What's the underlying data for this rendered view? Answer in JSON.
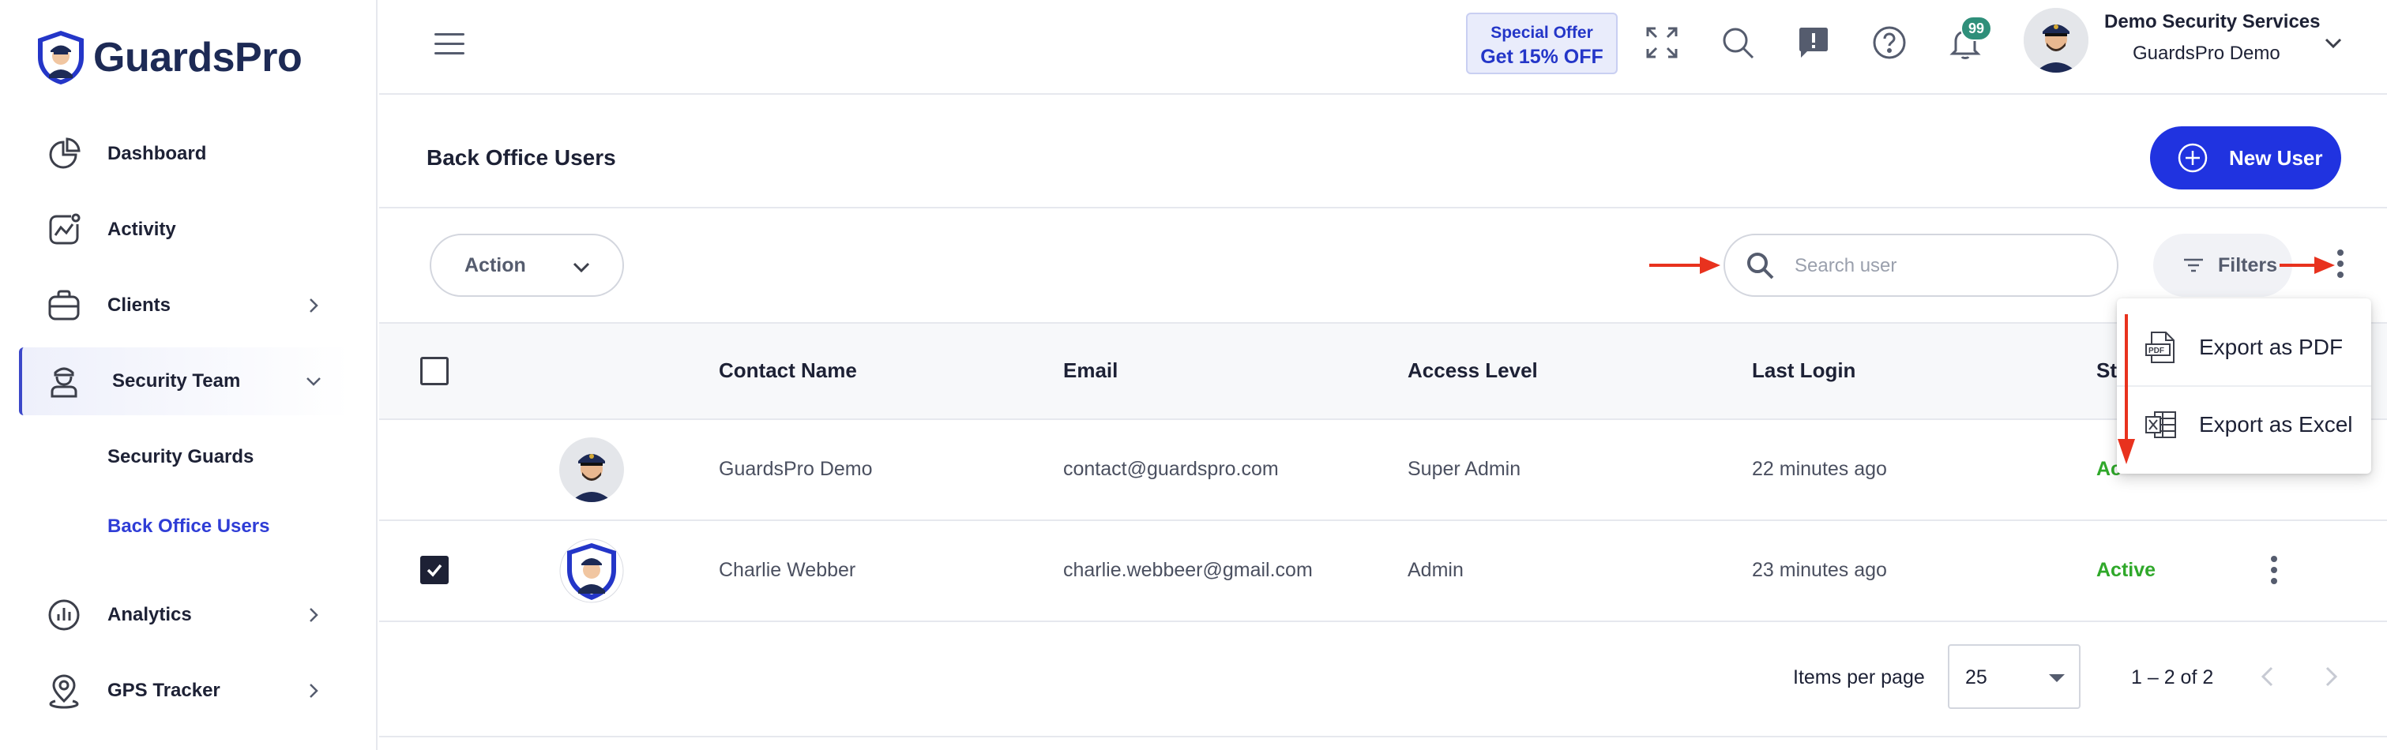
{
  "brand": {
    "name": "GuardsPro"
  },
  "sidebar": {
    "items": [
      {
        "label": "Dashboard",
        "icon": "pie-chart-icon"
      },
      {
        "label": "Activity",
        "icon": "activity-icon"
      },
      {
        "label": "Clients",
        "icon": "briefcase-icon"
      },
      {
        "label": "Security Team",
        "icon": "guard-icon"
      },
      {
        "label": "Analytics",
        "icon": "analytics-icon"
      },
      {
        "label": "GPS Tracker",
        "icon": "map-pin-icon"
      }
    ],
    "subitems": [
      {
        "label": "Security Guards"
      },
      {
        "label": "Back Office Users"
      }
    ],
    "active_item": "Security Team",
    "current_subitem": "Back Office Users"
  },
  "topbar": {
    "offer_line1": "Special Offer",
    "offer_line2": "Get 15% OFF",
    "notification_count": "99",
    "company_name": "Demo Security Services",
    "user_name": "GuardsPro Demo"
  },
  "page": {
    "title": "Back Office Users",
    "new_user_label": "New User"
  },
  "toolbar": {
    "action_label": "Action",
    "search_placeholder": "Search user",
    "filters_label": "Filters"
  },
  "table": {
    "columns": [
      "Contact Name",
      "Email",
      "Access Level",
      "Last Login",
      "St"
    ],
    "rows": [
      {
        "checked": false,
        "name": "GuardsPro Demo",
        "email": "contact@guardspro.com",
        "access": "Super Admin",
        "last_login": "22 minutes ago",
        "status": "Ac"
      },
      {
        "checked": true,
        "name": "Charlie Webber",
        "email": "charlie.webbeer@gmail.com",
        "access": "Admin",
        "last_login": "23 minutes ago",
        "status": "Active"
      }
    ]
  },
  "paginator": {
    "items_per_page_label": "Items per page",
    "items_per_page_value": "25",
    "range_label": "1 – 2 of 2"
  },
  "export_menu": {
    "items": [
      {
        "label": "Export as PDF",
        "icon": "pdf-file-icon"
      },
      {
        "label": "Export as Excel",
        "icon": "excel-file-icon"
      }
    ]
  },
  "colors": {
    "primary": "#2033e0",
    "active_nav": "#2f3dd6",
    "status_active": "#2fa82a",
    "badge": "#2f8f7a",
    "annotation_arrow": "#e8321e"
  }
}
